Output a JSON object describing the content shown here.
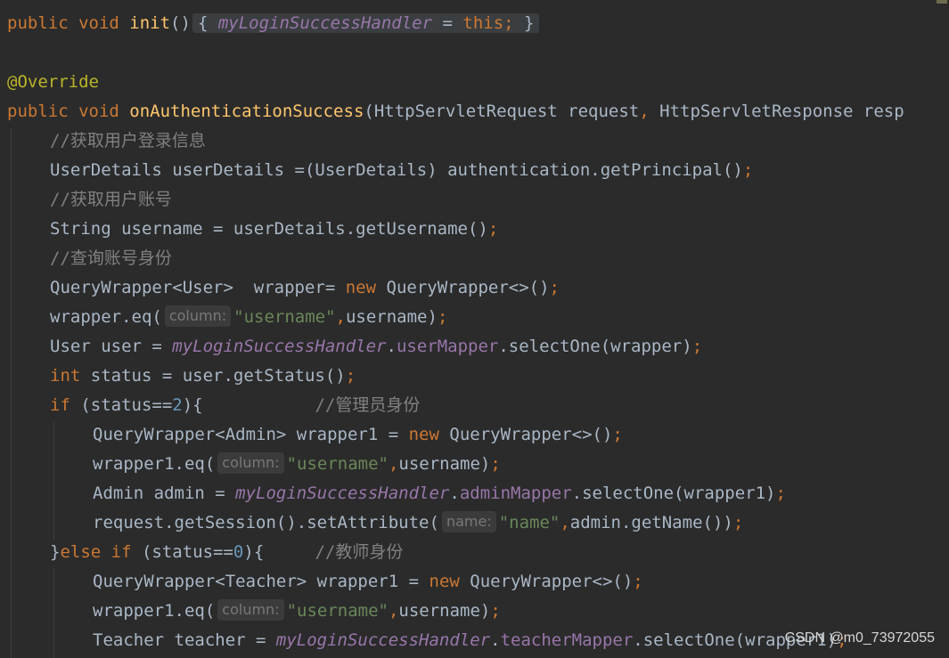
{
  "editor": {
    "lines": [
      {
        "indent": 0,
        "tokens": [
          [
            "kw",
            "public "
          ],
          [
            "kw",
            "void "
          ],
          [
            "fn",
            "init"
          ],
          [
            "pl",
            "()"
          ],
          [
            "fold",
            "{ ",
            [
              [
                "fld",
                "myLoginSuccessHandler"
              ],
              [
                "pl",
                " = "
              ],
              [
                "kw",
                "this;"
              ],
              [
                "pl",
                " }"
              ]
            ]
          ]
        ]
      },
      {
        "indent": 0,
        "tokens": []
      },
      {
        "indent": 0,
        "tokens": [
          [
            "ann",
            "@Override"
          ]
        ]
      },
      {
        "indent": 0,
        "tokens": [
          [
            "kw",
            "public "
          ],
          [
            "kw",
            "void "
          ],
          [
            "fn",
            "onAuthenticationSuccess"
          ],
          [
            "pl",
            "(HttpServletRequest request"
          ],
          [
            "kw",
            ", "
          ],
          [
            "pl",
            "HttpServletResponse resp"
          ]
        ]
      },
      {
        "indent": 1,
        "tokens": [
          [
            "cmt",
            "//获取用户登录信息"
          ]
        ]
      },
      {
        "indent": 1,
        "tokens": [
          [
            "pl",
            "UserDetails userDetails =(UserDetails) authentication.getPrincipal()"
          ],
          [
            "kw",
            ";"
          ]
        ]
      },
      {
        "indent": 1,
        "tokens": [
          [
            "cmt",
            "//获取用户账号"
          ]
        ]
      },
      {
        "indent": 1,
        "tokens": [
          [
            "pl",
            "String username = userDetails.getUsername()"
          ],
          [
            "kw",
            ";"
          ]
        ]
      },
      {
        "indent": 1,
        "tokens": [
          [
            "cmt",
            "//查询账号身份"
          ]
        ]
      },
      {
        "indent": 1,
        "tokens": [
          [
            "pl",
            "QueryWrapper<User>  wrapper= "
          ],
          [
            "kw",
            "new "
          ],
          [
            "pl",
            "QueryWrapper<>()"
          ],
          [
            "kw",
            ";"
          ]
        ]
      },
      {
        "indent": 1,
        "tokens": [
          [
            "pl",
            "wrapper.eq("
          ],
          [
            "hint",
            "column:"
          ],
          [
            "str",
            "\"username\""
          ],
          [
            "kw",
            ","
          ],
          [
            "pl",
            "username)"
          ],
          [
            "kw",
            ";"
          ]
        ]
      },
      {
        "indent": 1,
        "tokens": [
          [
            "pl",
            "User user = "
          ],
          [
            "fld",
            "myLoginSuccessHandler"
          ],
          [
            "pl",
            "."
          ],
          [
            "ifld",
            "userMapper"
          ],
          [
            "pl",
            ".selectOne(wrapper)"
          ],
          [
            "kw",
            ";"
          ]
        ]
      },
      {
        "indent": 1,
        "tokens": [
          [
            "kw",
            "int "
          ],
          [
            "pl",
            "status = user.getStatus()"
          ],
          [
            "kw",
            ";"
          ]
        ]
      },
      {
        "indent": 1,
        "tokens": [
          [
            "kw",
            "if "
          ],
          [
            "pl",
            "(status=="
          ],
          [
            "num",
            "2"
          ],
          [
            "pl",
            "){           "
          ],
          [
            "cmt",
            "//管理员身份"
          ]
        ]
      },
      {
        "indent": 2,
        "tokens": [
          [
            "pl",
            "QueryWrapper<Admin> wrapper1 = "
          ],
          [
            "kw",
            "new "
          ],
          [
            "pl",
            "QueryWrapper<>()"
          ],
          [
            "kw",
            ";"
          ]
        ]
      },
      {
        "indent": 2,
        "tokens": [
          [
            "pl",
            "wrapper1.eq("
          ],
          [
            "hint",
            "column:"
          ],
          [
            "str",
            "\"username\""
          ],
          [
            "kw",
            ","
          ],
          [
            "pl",
            "username)"
          ],
          [
            "kw",
            ";"
          ]
        ]
      },
      {
        "indent": 2,
        "tokens": [
          [
            "pl",
            "Admin admin = "
          ],
          [
            "fld",
            "myLoginSuccessHandler"
          ],
          [
            "pl",
            "."
          ],
          [
            "ifld",
            "adminMapper"
          ],
          [
            "pl",
            ".selectOne(wrapper1)"
          ],
          [
            "kw",
            ";"
          ]
        ]
      },
      {
        "indent": 2,
        "tokens": [
          [
            "pl",
            "request.getSession().setAttribute("
          ],
          [
            "hint",
            "name:"
          ],
          [
            "str",
            "\"name\""
          ],
          [
            "kw",
            ","
          ],
          [
            "pl",
            "admin.getName())"
          ],
          [
            "kw",
            ";"
          ]
        ]
      },
      {
        "indent": 1,
        "tokens": [
          [
            "pl",
            "}"
          ],
          [
            "kw",
            "else if "
          ],
          [
            "pl",
            "(status=="
          ],
          [
            "num",
            "0"
          ],
          [
            "pl",
            "){     "
          ],
          [
            "cmt",
            "//教师身份"
          ]
        ]
      },
      {
        "indent": 2,
        "tokens": [
          [
            "pl",
            "QueryWrapper<Teacher> wrapper1 = "
          ],
          [
            "kw",
            "new "
          ],
          [
            "pl",
            "QueryWrapper<>()"
          ],
          [
            "kw",
            ";"
          ]
        ]
      },
      {
        "indent": 2,
        "tokens": [
          [
            "pl",
            "wrapper1.eq("
          ],
          [
            "hint",
            "column:"
          ],
          [
            "str",
            "\"username\""
          ],
          [
            "kw",
            ","
          ],
          [
            "pl",
            "username)"
          ],
          [
            "kw",
            ";"
          ]
        ]
      },
      {
        "indent": 2,
        "tokens": [
          [
            "pl",
            "Teacher teacher = "
          ],
          [
            "fld",
            "myLoginSuccessHandler"
          ],
          [
            "pl",
            "."
          ],
          [
            "ifld",
            "teacherMapper"
          ],
          [
            "pl",
            ".selectOne(wrapper1)"
          ],
          [
            "kw",
            ";"
          ]
        ]
      }
    ]
  },
  "watermark": "CSDN @m0_73972055"
}
